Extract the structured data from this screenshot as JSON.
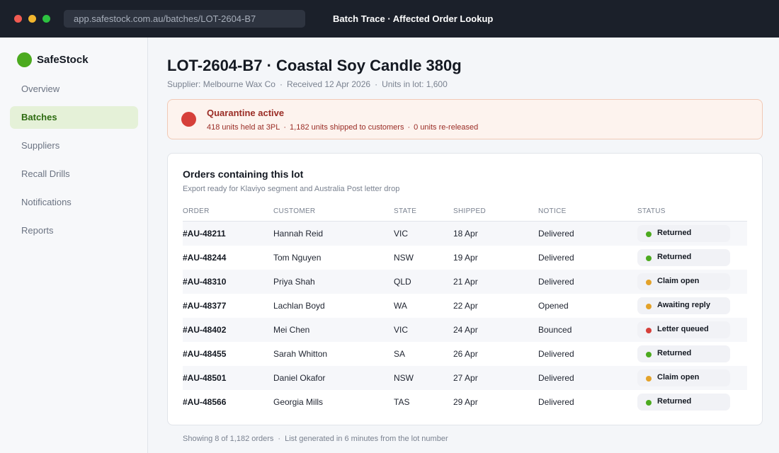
{
  "window": {
    "url": "app.safestock.com.au/batches/LOT-2604-B7",
    "title": "Batch Trace  ·  Affected Order Lookup"
  },
  "sidebar": {
    "brand": "SafeStock",
    "brand_color": "#4caa1f",
    "items": [
      {
        "label": "Overview",
        "active": false
      },
      {
        "label": "Batches",
        "active": true
      },
      {
        "label": "Suppliers",
        "active": false
      },
      {
        "label": "Recall Drills",
        "active": false
      },
      {
        "label": "Notifications",
        "active": false
      },
      {
        "label": "Reports",
        "active": false
      }
    ]
  },
  "header": {
    "title": "LOT-2604-B7  ·  Coastal Soy Candle 380g",
    "supplier": "Supplier: Melbourne Wax Co",
    "received": "Received 12 Apr 2026",
    "units": "Units in lot: 1,600"
  },
  "alert": {
    "title": "Quarantine active",
    "held": "418 units held at 3PL",
    "shipped": "1,182 units shipped to customers",
    "released": "0 units re-released",
    "color": "#d6403a"
  },
  "orders": {
    "title": "Orders containing this lot",
    "subtitle": "Export ready for Klaviyo segment and Australia Post letter drop",
    "columns": [
      "ORDER",
      "CUSTOMER",
      "STATE",
      "SHIPPED",
      "NOTICE",
      "STATUS"
    ],
    "rows": [
      {
        "order": "#AU-48211",
        "customer": "Hannah Reid",
        "state": "VIC",
        "shipped": "18 Apr",
        "notice": "Delivered",
        "status": "Returned",
        "status_color": "#4caa1f"
      },
      {
        "order": "#AU-48244",
        "customer": "Tom Nguyen",
        "state": "NSW",
        "shipped": "19 Apr",
        "notice": "Delivered",
        "status": "Returned",
        "status_color": "#4caa1f"
      },
      {
        "order": "#AU-48310",
        "customer": "Priya Shah",
        "state": "QLD",
        "shipped": "21 Apr",
        "notice": "Delivered",
        "status": "Claim open",
        "status_color": "#e3a22a"
      },
      {
        "order": "#AU-48377",
        "customer": "Lachlan Boyd",
        "state": "WA",
        "shipped": "22 Apr",
        "notice": "Opened",
        "status": "Awaiting reply",
        "status_color": "#e3a22a"
      },
      {
        "order": "#AU-48402",
        "customer": "Mei Chen",
        "state": "VIC",
        "shipped": "24 Apr",
        "notice": "Bounced",
        "status": "Letter queued",
        "status_color": "#d6403a"
      },
      {
        "order": "#AU-48455",
        "customer": "Sarah Whitton",
        "state": "SA",
        "shipped": "26 Apr",
        "notice": "Delivered",
        "status": "Returned",
        "status_color": "#4caa1f"
      },
      {
        "order": "#AU-48501",
        "customer": "Daniel Okafor",
        "state": "NSW",
        "shipped": "27 Apr",
        "notice": "Delivered",
        "status": "Claim open",
        "status_color": "#e3a22a"
      },
      {
        "order": "#AU-48566",
        "customer": "Georgia Mills",
        "state": "TAS",
        "shipped": "29 Apr",
        "notice": "Delivered",
        "status": "Returned",
        "status_color": "#4caa1f"
      }
    ]
  },
  "footer": {
    "showing": "Showing 8 of 1,182 orders",
    "generated": "List generated in 6 minutes from the lot number"
  }
}
